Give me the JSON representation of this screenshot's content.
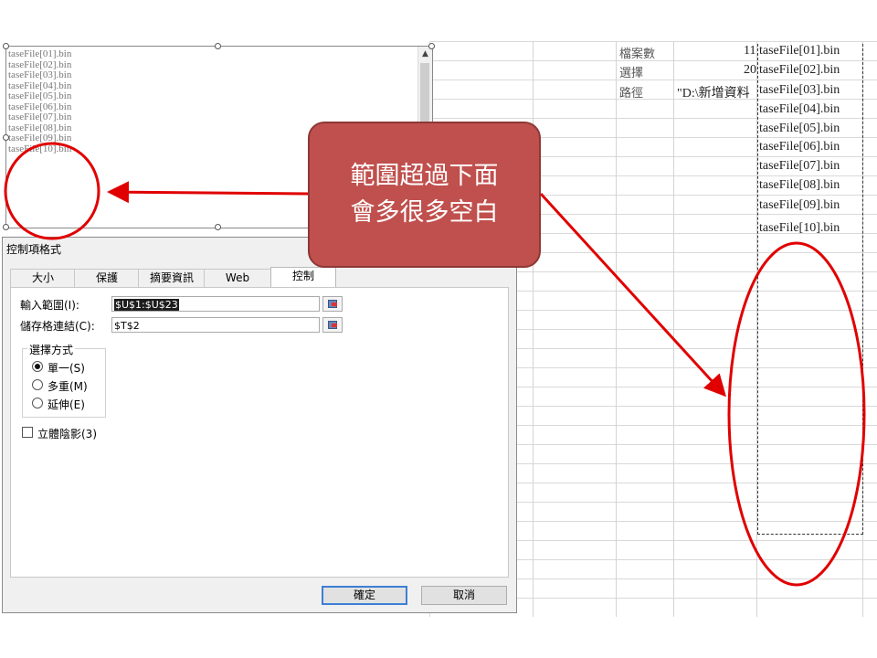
{
  "sheet": {
    "labels": [
      "檔案數",
      "選擇",
      "路徑"
    ],
    "values": [
      "11",
      "20",
      "\"D:\\新增資料"
    ],
    "file_list": [
      "taseFile[01].bin",
      "taseFile[02].bin",
      "taseFile[03].bin",
      "taseFile[04].bin",
      "taseFile[05].bin",
      "taseFile[06].bin",
      "taseFile[07].bin",
      "taseFile[08].bin",
      "taseFile[09].bin",
      "taseFile[10].bin"
    ]
  },
  "listbox": {
    "items": [
      "taseFile[01].bin",
      "taseFile[02].bin",
      "taseFile[03].bin",
      "taseFile[04].bin",
      "taseFile[05].bin",
      "taseFile[06].bin",
      "taseFile[07].bin",
      "taseFile[08].bin",
      "taseFile[09].bin",
      "taseFile[10].bin"
    ],
    "scroll_up_glyph": "▲"
  },
  "dialog": {
    "title": "控制項格式",
    "tabs": [
      "大小",
      "保護",
      "摘要資訊",
      "Web",
      "控制"
    ],
    "active_tab": "控制",
    "input_range_label": "輸入範圍(I):",
    "input_range_value": "$U$1:$U$23",
    "cell_link_label": "儲存格連結(C):",
    "cell_link_value": "$T$2",
    "selection_type_title": "選擇方式",
    "options": [
      "單一(S)",
      "多重(M)",
      "延伸(E)"
    ],
    "selected_option": "單一(S)",
    "shading_label": "立體陰影(3)",
    "ok_label": "確定",
    "cancel_label": "取消"
  },
  "callout": {
    "line1": "範圍超過下面",
    "line2": "會多很多空白"
  },
  "colors": {
    "annotation_red": "#e00000",
    "callout_fill": "#c0504d",
    "callout_border": "#8c3836"
  }
}
